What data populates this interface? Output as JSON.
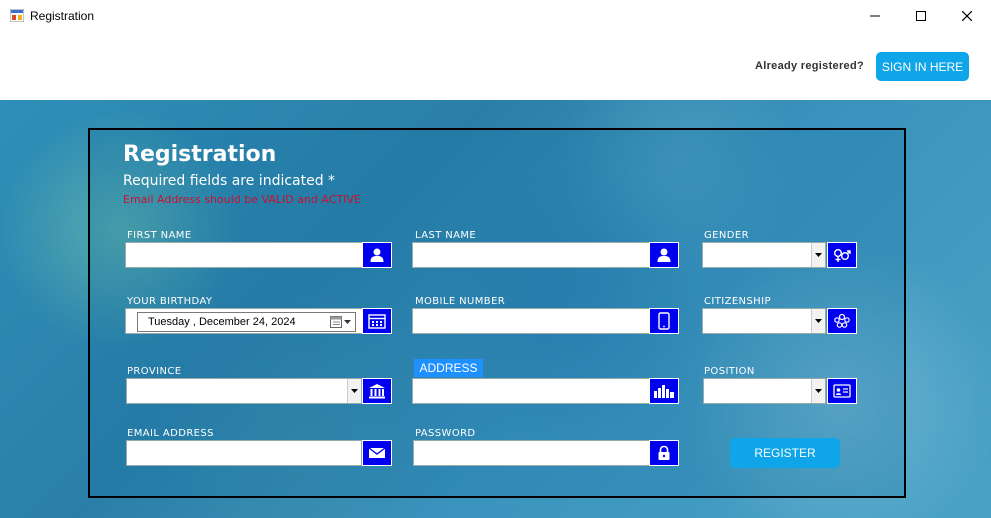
{
  "window": {
    "title": "Registration",
    "controls": {
      "minimize": "minimize-icon",
      "maximize": "maximize-icon",
      "close": "close-icon"
    }
  },
  "header": {
    "already_registered": "Already registered?",
    "sign_in_label": "SIGN IN HERE"
  },
  "form": {
    "title": "Registration",
    "required_note": "Required fields are indicated *",
    "email_note": "Email Address should be VALID and ACTIVE",
    "fields": {
      "first_name": {
        "label": "FIRST NAME",
        "value": "",
        "icon": "user-icon"
      },
      "last_name": {
        "label": "LAST NAME",
        "value": "",
        "icon": "user-icon"
      },
      "gender": {
        "label": "GENDER",
        "value": "",
        "icon": "gender-icon"
      },
      "birthday": {
        "label": "YOUR BIRTHDAY",
        "value": "Tuesday   ,  December 24, 2024",
        "icon": "calendar-icon"
      },
      "mobile": {
        "label": "MOBILE NUMBER",
        "value": "",
        "icon": "mobile-phone-icon"
      },
      "citizenship": {
        "label": "CITIZENSHIP",
        "value": "",
        "icon": "people-group-icon"
      },
      "province": {
        "label": "PROVINCE",
        "value": "",
        "icon": "government-building-icon"
      },
      "address": {
        "label": "ADDRESS",
        "value": "",
        "icon": "city-skyline-icon"
      },
      "position": {
        "label": "POSITION",
        "value": "",
        "icon": "id-card-icon"
      },
      "email": {
        "label": "EMAIL ADDRESS",
        "value": "",
        "icon": "envelope-icon"
      },
      "password": {
        "label": "PASSWORD",
        "value": "",
        "icon": "lock-icon"
      }
    },
    "register_label": "REGISTER"
  },
  "colors": {
    "accent": "#0ea5e9",
    "icon_button": "#0000ee",
    "warning_text": "#c8102e",
    "address_badge": "#1e90ff"
  }
}
